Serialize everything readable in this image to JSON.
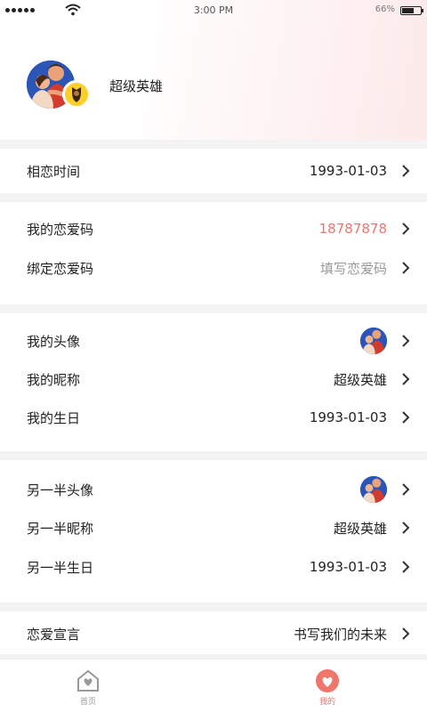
{
  "status_bar": {
    "time": "3:00 PM",
    "battery_text": "66%",
    "battery_level": 0.66
  },
  "profile": {
    "name": "超级英雄",
    "avatar_icon": "couple-avatar",
    "badge_icon": "guardian-badge-icon"
  },
  "rows": {
    "love_time": {
      "label": "相恋时间",
      "value": "1993-01-03"
    },
    "my_code": {
      "label": "我的恋爱码",
      "value": "18787878"
    },
    "bind_code": {
      "label": "绑定恋爱码",
      "value": "填写恋爱码"
    },
    "my_avatar": {
      "label": "我的头像"
    },
    "my_nickname": {
      "label": "我的昵称",
      "value": "超级英雄"
    },
    "my_birthday": {
      "label": "我的生日",
      "value": "1993-01-03"
    },
    "partner_avatar": {
      "label": "另一半头像"
    },
    "partner_nickname": {
      "label": "另一半昵称",
      "value": "超级英雄"
    },
    "partner_birthday": {
      "label": "另一半生日",
      "value": "1993-01-03"
    },
    "declaration": {
      "label": "恋爱宣言",
      "value": "书写我们的未来"
    }
  },
  "tabbar": {
    "home": {
      "label": "首页",
      "icon": "home-heart-icon"
    },
    "mine": {
      "label": "我的",
      "icon": "mine-heart-icon"
    }
  },
  "colors": {
    "accent": "#f0756b",
    "header_gradient_end": "#fde9ea",
    "background": "#f3f3f3"
  }
}
